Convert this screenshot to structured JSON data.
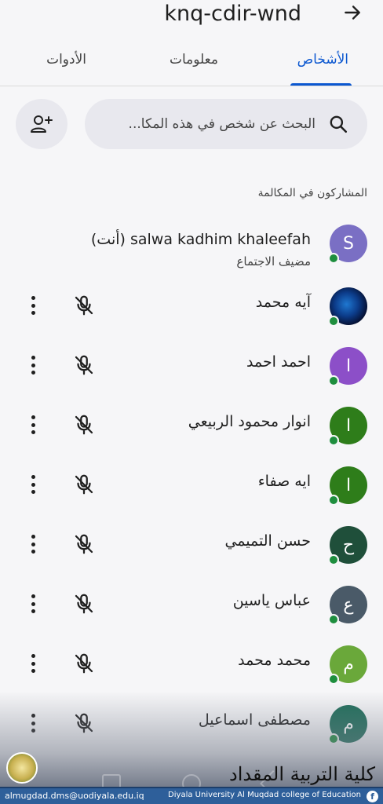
{
  "header": {
    "meet_code": "knq-cdir-wnd"
  },
  "tabs": [
    {
      "label": "الأشخاص",
      "active": true
    },
    {
      "label": "معلومات",
      "active": false
    },
    {
      "label": "الأدوات",
      "active": false
    }
  ],
  "search": {
    "placeholder": "البحث عن شخص في هذه المكا..."
  },
  "section_label": "المشاركون في المكالمة",
  "participants": [
    {
      "name": "salwa kadhim khaleefah (أنت)",
      "role": "مضيف الاجتماع",
      "avatar_letter": "S",
      "avatar_color": "#7a6fc4"
    },
    {
      "name": "آيه محمد",
      "avatar_letter": "",
      "avatar_color": "#0c3c8a"
    },
    {
      "name": "احمد احمد",
      "avatar_letter": "ا",
      "avatar_color": "#8c4fc8"
    },
    {
      "name": "انوار محمود الربيعي",
      "avatar_letter": "ا",
      "avatar_color": "#2e7d1a"
    },
    {
      "name": "ايه صفاء",
      "avatar_letter": "ا",
      "avatar_color": "#2e7d1a"
    },
    {
      "name": "حسن التميمي",
      "avatar_letter": "ح",
      "avatar_color": "#1f4f3a"
    },
    {
      "name": "عباس ياسين",
      "avatar_letter": "ع",
      "avatar_color": "#4a5a68"
    },
    {
      "name": "محمد محمد",
      "avatar_letter": "م",
      "avatar_color": "#6aa83a"
    },
    {
      "name": "مصطفى اسماعيل",
      "avatar_letter": "م",
      "avatar_color": "#1f6e5a"
    }
  ],
  "watermark": {
    "email": "almugdad.dms@uodiyala.edu.iq",
    "college": "Diyala University Al Muqdad college of Education",
    "logo_text": "كلية التربية المقداد",
    "fb_glyph": "f"
  }
}
